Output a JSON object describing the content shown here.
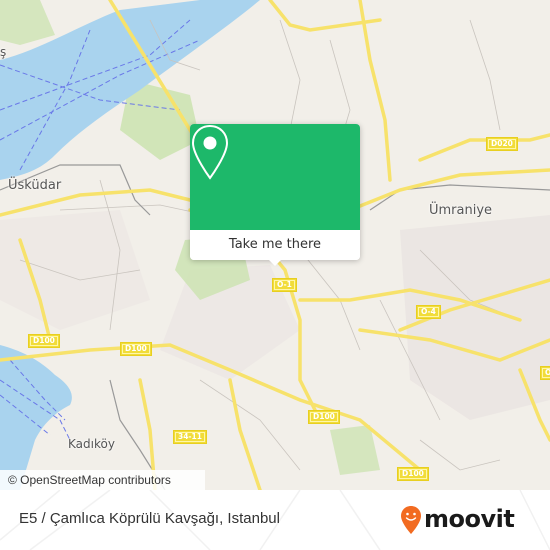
{
  "map": {
    "place_labels": [
      {
        "id": "uskudar",
        "text": "Üsküdar"
      },
      {
        "id": "umraniye",
        "text": "Ümraniye"
      },
      {
        "id": "kadikoy",
        "text": "Kadıköy"
      },
      {
        "id": "besiktas-partial",
        "text": "ş"
      }
    ],
    "road_shields": [
      {
        "id": "d020",
        "text": "D020"
      },
      {
        "id": "o1",
        "text": "O-1"
      },
      {
        "id": "o4",
        "text": "O-4"
      },
      {
        "id": "d100-west",
        "text": "D100"
      },
      {
        "id": "d100-mid",
        "text": "D100"
      },
      {
        "id": "d100-east",
        "text": "D100"
      },
      {
        "id": "d100-south",
        "text": "D100"
      },
      {
        "id": "3411",
        "text": "34-11"
      },
      {
        "id": "right-edge-partial",
        "text": "O"
      }
    ],
    "attribution": "© OpenStreetMap contributors",
    "colors": {
      "water": "#a9d3ee",
      "land": "#f2efe9",
      "major_road": "#f7e26b",
      "park": "#cde3b3",
      "popup_green": "#1db86a"
    }
  },
  "popup": {
    "icon": "map-pin-icon",
    "action_label": "Take me there"
  },
  "footer": {
    "stop_name": "E5 / Çamlıca Köprülü Kavşağı, Istanbul",
    "brand": "moovit",
    "brand_color": "#f26b21"
  }
}
